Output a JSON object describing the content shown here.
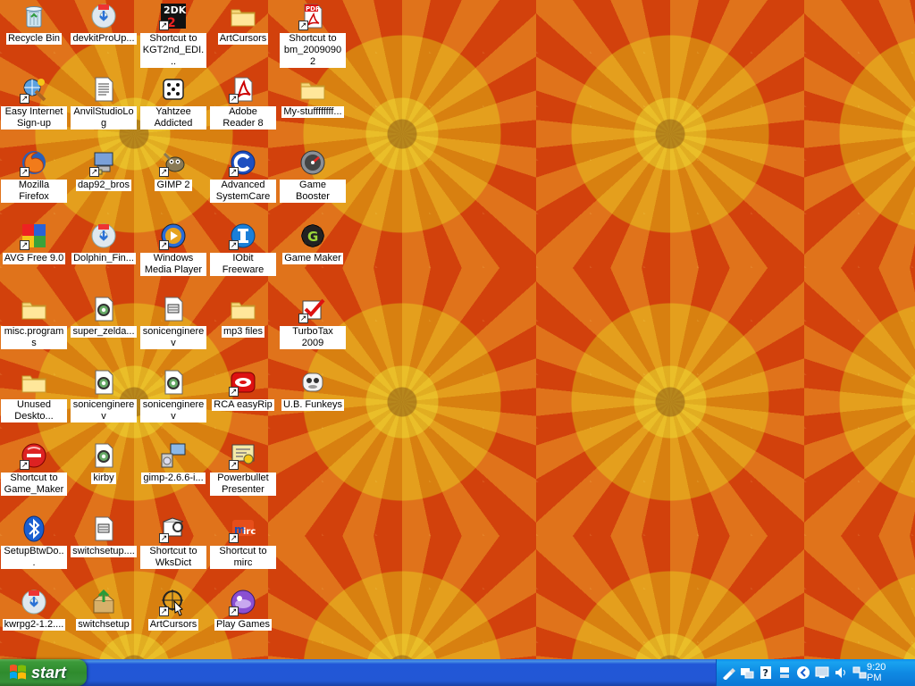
{
  "desktop": {
    "icons": [
      {
        "label": "Recycle Bin",
        "icon": "recycle-bin-icon",
        "shortcut": false
      },
      {
        "label": "Easy Internet Sign-up",
        "icon": "easy-internet-icon",
        "shortcut": true
      },
      {
        "label": "Mozilla Firefox",
        "icon": "firefox-icon",
        "shortcut": true
      },
      {
        "label": "AVG Free 9.0",
        "icon": "avg-icon",
        "shortcut": true
      },
      {
        "label": "misc.programs",
        "icon": "folder-icon",
        "shortcut": false
      },
      {
        "label": "Unused Deskto...",
        "icon": "folder-icon",
        "shortcut": false
      },
      {
        "label": "Shortcut to Game_Maker",
        "icon": "game-maker-red-icon",
        "shortcut": true
      },
      {
        "label": "SetupBtwDo...",
        "icon": "bluetooth-icon",
        "shortcut": false
      },
      {
        "label": "kwrpg2-1.2....",
        "icon": "installer-disc-icon",
        "shortcut": false
      },
      {
        "label": "devkitProUp...",
        "icon": "installer-disc-icon",
        "shortcut": false
      },
      {
        "label": "AnvilStudioLog",
        "icon": "text-document-icon",
        "shortcut": false
      },
      {
        "label": "dap92_bros",
        "icon": "computer-app-icon",
        "shortcut": true
      },
      {
        "label": "Dolphin_Fin...",
        "icon": "installer-disc-icon",
        "shortcut": false
      },
      {
        "label": "super_zelda...",
        "icon": "gear-file-icon",
        "shortcut": false
      },
      {
        "label": "sonicenginerev",
        "icon": "gear-file-icon",
        "shortcut": false
      },
      {
        "label": "kirby",
        "icon": "gear-file-icon",
        "shortcut": false
      },
      {
        "label": "switchsetup....",
        "icon": "config-file-icon",
        "shortcut": false
      },
      {
        "label": "switchsetup",
        "icon": "setup-box-icon",
        "shortcut": false
      },
      {
        "label": "Shortcut to KGT2nd_EDI...",
        "icon": "kgt-2dk-icon",
        "shortcut": true
      },
      {
        "label": "Yahtzee Addicted",
        "icon": "dice-icon",
        "shortcut": false
      },
      {
        "label": "GIMP 2",
        "icon": "gimp-icon",
        "shortcut": true
      },
      {
        "label": "Windows Media Player",
        "icon": "media-player-icon",
        "shortcut": true
      },
      {
        "label": "sonicenginerev",
        "icon": "config-file-icon",
        "shortcut": false
      },
      {
        "label": "sonicenginerev",
        "icon": "gear-file-icon",
        "shortcut": false
      },
      {
        "label": "gimp-2.6.6-i...",
        "icon": "setup-computer-icon",
        "shortcut": false
      },
      {
        "label": "Shortcut to WksDict",
        "icon": "dictionary-icon",
        "shortcut": true
      },
      {
        "label": "ArtCursors",
        "icon": "cursor-target-icon",
        "shortcut": true
      },
      {
        "label": "ArtCursors",
        "icon": "folder-icon",
        "shortcut": false
      },
      {
        "label": "Adobe Reader 8",
        "icon": "adobe-reader-icon",
        "shortcut": true
      },
      {
        "label": "Advanced SystemCare",
        "icon": "systemcare-icon",
        "shortcut": true
      },
      {
        "label": "IObit Freeware",
        "icon": "iobit-icon",
        "shortcut": true
      },
      {
        "label": "mp3 files",
        "icon": "folder-icon",
        "shortcut": false
      },
      {
        "label": "RCA easyRip",
        "icon": "rca-easyrip-icon",
        "shortcut": true
      },
      {
        "label": "Powerbullet Presenter",
        "icon": "presenter-icon",
        "shortcut": true
      },
      {
        "label": "Shortcut to mirc",
        "icon": "mirc-icon",
        "shortcut": true
      },
      {
        "label": "Play Games",
        "icon": "play-games-icon",
        "shortcut": true
      },
      {
        "label": "Shortcut to bm_20090902",
        "icon": "pdf-file-icon",
        "shortcut": true
      },
      {
        "label": "My-stuffffffff...",
        "icon": "folder-icon",
        "shortcut": false
      },
      {
        "label": "Game Booster",
        "icon": "game-booster-icon",
        "shortcut": false
      },
      {
        "label": "Game Maker",
        "icon": "game-maker-icon",
        "shortcut": false
      },
      {
        "label": "TurboTax 2009",
        "icon": "turbotax-icon",
        "shortcut": true
      },
      {
        "label": "U.B. Funkeys",
        "icon": "funkeys-icon",
        "shortcut": false
      }
    ]
  },
  "taskbar": {
    "start_label": "start",
    "tray_icons": [
      "pen-tool-icon",
      "network-icon",
      "help-icon",
      "notification-icon",
      "arrow-left-icon",
      "monitor-icon",
      "speaker-icon",
      "network-computers-icon"
    ],
    "clock": "9:20 PM"
  },
  "colors": {
    "taskbar_blue": "#2257d5",
    "start_green": "#3c9a3a",
    "tray_blue": "#0f8ae3",
    "wallpaper_orange": "#d2410c",
    "wallpaper_yellow": "#e6d228"
  }
}
